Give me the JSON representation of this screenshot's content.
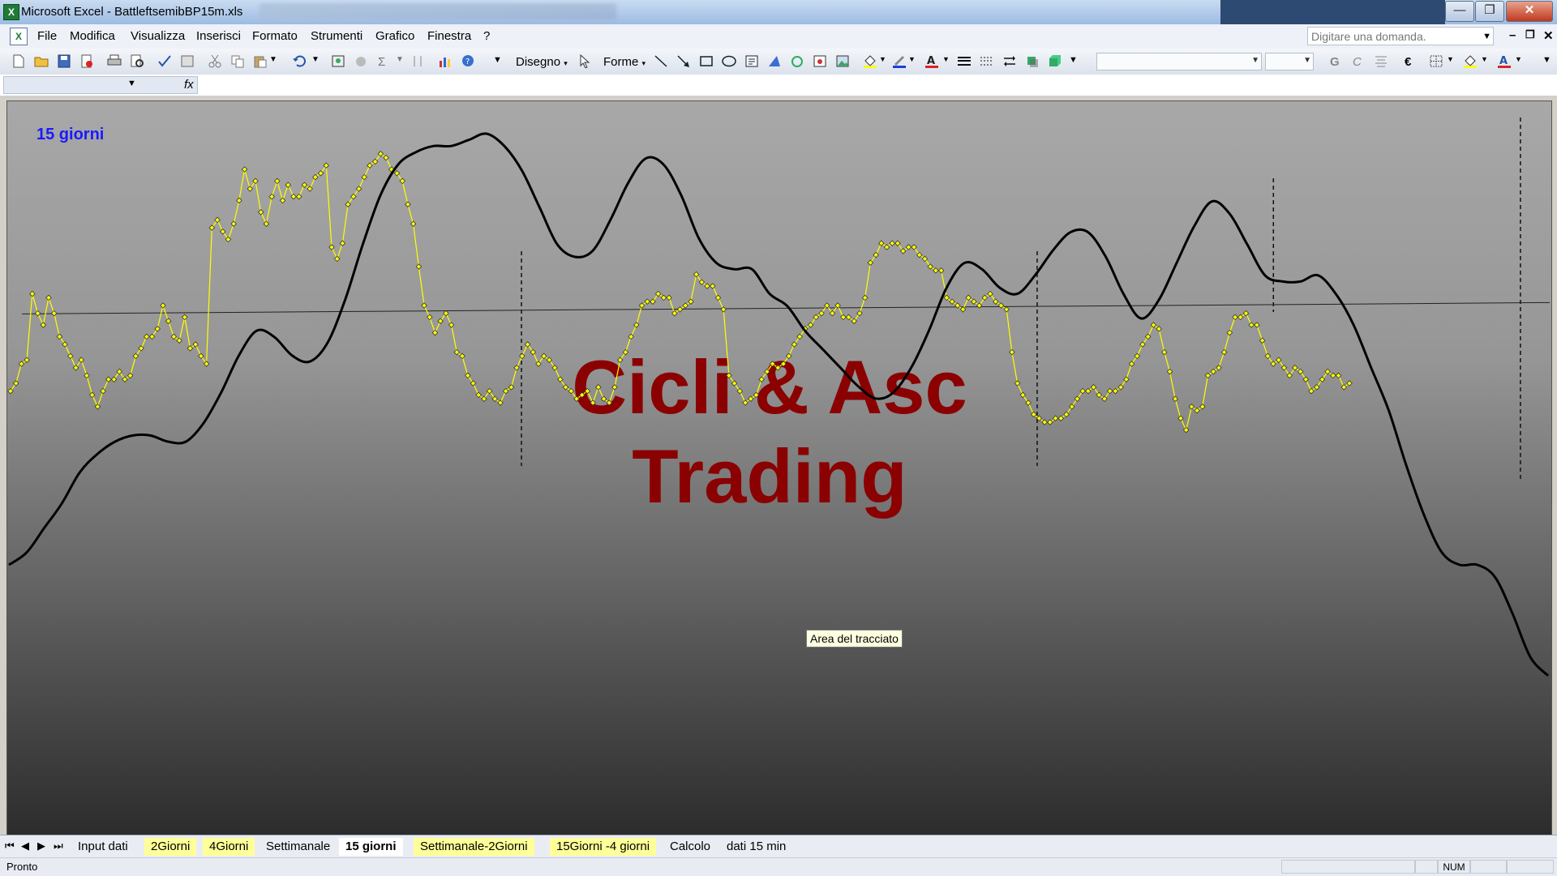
{
  "window": {
    "title": "Microsoft Excel - BattleftsemibBP15m.xls",
    "controls": {
      "minimize": "—",
      "restore": "❐",
      "close": "✕"
    }
  },
  "menubar": {
    "items": [
      "File",
      "Modifica",
      "Visualizza",
      "Inserisci",
      "Formato",
      "Strumenti",
      "Grafico",
      "Finestra",
      "?"
    ],
    "help_placeholder": "Digitare una domanda.",
    "doc_controls": {
      "minimize": "–",
      "restore": "❐",
      "close": "✕"
    }
  },
  "toolbar": {
    "drawing_label": "Disegno",
    "shapes_label": "Forme",
    "font_bold": "G",
    "font_italic": "C"
  },
  "formula_bar": {
    "name_box": "",
    "fx": "fx"
  },
  "chart": {
    "title": "15 giorni",
    "watermark_line1": "Cicli & Asc",
    "watermark_line2": "Trading",
    "tooltip": "Area del tracciato",
    "colors": {
      "background_top": "#a8a8a8",
      "background_bottom": "#2c2c2c",
      "price_line": "#ffff00",
      "cycle_line": "#000000",
      "watermark": "#8b0000",
      "title": "#1a1aff"
    }
  },
  "chart_data": {
    "type": "line",
    "title": "15 giorni",
    "series": [
      {
        "values": [
          0.38,
          0.4,
          0.45,
          0.46,
          0.63,
          0.58,
          0.55,
          0.62,
          0.58,
          0.52,
          0.5,
          0.47,
          0.44,
          0.46,
          0.42,
          0.37,
          0.34,
          0.38,
          0.41,
          0.41,
          0.43,
          0.41,
          0.42,
          0.47,
          0.49,
          0.52,
          0.52,
          0.54,
          0.6,
          0.56,
          0.52,
          0.51,
          0.57,
          0.49,
          0.5,
          0.47,
          0.45,
          0.8,
          0.82,
          0.79,
          0.77,
          0.81,
          0.87,
          0.95,
          0.9,
          0.92,
          0.84,
          0.81,
          0.88,
          0.92,
          0.87,
          0.91,
          0.88,
          0.88,
          0.91,
          0.9,
          0.93,
          0.94,
          0.96,
          0.75,
          0.72,
          0.76,
          0.86,
          0.88,
          0.9,
          0.93,
          0.96,
          0.97,
          0.99,
          0.98,
          0.95,
          0.94,
          0.92,
          0.86,
          0.81,
          0.7,
          0.6,
          0.57,
          0.53,
          0.56,
          0.58,
          0.55,
          0.48,
          0.47,
          0.42,
          0.4,
          0.37,
          0.36,
          0.38,
          0.36,
          0.35,
          0.38,
          0.39,
          0.44,
          0.47,
          0.5,
          0.48,
          0.45,
          0.47,
          0.46,
          0.44,
          0.41,
          0.39,
          0.38,
          0.36,
          0.37,
          0.38,
          0.35,
          0.39,
          0.36,
          0.35,
          0.39,
          0.46,
          0.48,
          0.52,
          0.55,
          0.6,
          0.61,
          0.61,
          0.63,
          0.62,
          0.62,
          0.58,
          0.59,
          0.6,
          0.61,
          0.68,
          0.66,
          0.65,
          0.65,
          0.62,
          0.59,
          0.42,
          0.4,
          0.38,
          0.35,
          0.36,
          0.37,
          0.41,
          0.43,
          0.45,
          0.44,
          0.45,
          0.47,
          0.5,
          0.52,
          0.54,
          0.55,
          0.57,
          0.58,
          0.6,
          0.58,
          0.6,
          0.57,
          0.57,
          0.56,
          0.58,
          0.62,
          0.71,
          0.73,
          0.76,
          0.75,
          0.76,
          0.76,
          0.74,
          0.75,
          0.75,
          0.73,
          0.72,
          0.7,
          0.69,
          0.69,
          0.62,
          0.61,
          0.6,
          0.59,
          0.62,
          0.61,
          0.6,
          0.62,
          0.63,
          0.61,
          0.6,
          0.59,
          0.48,
          0.4,
          0.37,
          0.35,
          0.32,
          0.31,
          0.3,
          0.3,
          0.31,
          0.31,
          0.32,
          0.34,
          0.36,
          0.38,
          0.38,
          0.39,
          0.37,
          0.36,
          0.38,
          0.38,
          0.39,
          0.41,
          0.45,
          0.47,
          0.5,
          0.52,
          0.55,
          0.54,
          0.48,
          0.43,
          0.36,
          0.31,
          0.28,
          0.34,
          0.33,
          0.34,
          0.42,
          0.43,
          0.44,
          0.48,
          0.53,
          0.57,
          0.57,
          0.58,
          0.55,
          0.55,
          0.51,
          0.47,
          0.45,
          0.46,
          0.44,
          0.42,
          0.44,
          0.43,
          0.41,
          0.38,
          0.39,
          0.41,
          0.43,
          0.42,
          0.42,
          0.39,
          0.4
        ]
      },
      {
        "values": [
          0.3,
          0.32,
          0.36,
          0.4,
          0.45,
          0.48,
          0.5,
          0.51,
          0.51,
          0.5,
          0.5,
          0.53,
          0.58,
          0.64,
          0.68,
          0.67,
          0.64,
          0.63,
          0.66,
          0.73,
          0.82,
          0.9,
          0.95,
          0.97,
          0.98,
          0.98,
          0.99,
          1.0,
          0.98,
          0.94,
          0.88,
          0.82,
          0.8,
          0.81,
          0.86,
          0.92,
          0.96,
          0.95,
          0.9,
          0.83,
          0.79,
          0.78,
          0.78,
          0.74,
          0.72,
          0.68,
          0.65,
          0.62,
          0.59,
          0.57,
          0.58,
          0.62,
          0.68,
          0.75,
          0.79,
          0.78,
          0.75,
          0.74,
          0.77,
          0.81,
          0.84,
          0.84,
          0.8,
          0.74,
          0.7,
          0.73,
          0.79,
          0.85,
          0.89,
          0.87,
          0.82,
          0.77,
          0.76,
          0.76,
          0.77,
          0.74,
          0.69,
          0.62,
          0.55,
          0.46,
          0.38,
          0.32,
          0.3,
          0.3,
          0.28,
          0.22,
          0.15,
          0.12
        ]
      }
    ],
    "mean_line": 0.72,
    "cycle_markers": [
      0.333,
      0.667,
      0.82,
      0.98
    ]
  },
  "sheet_tabs": [
    {
      "label": "Input dati",
      "color": "none"
    },
    {
      "label": "2Giorni",
      "color": "yellow"
    },
    {
      "label": "4Giorni",
      "color": "yellow"
    },
    {
      "label": "Settimanale",
      "color": "none"
    },
    {
      "label": "15 giorni",
      "color": "active"
    },
    {
      "label": "Settimanale-2Giorni",
      "color": "yellow"
    },
    {
      "label": "15Giorni -4 giorni",
      "color": "yellow"
    },
    {
      "label": "Calcolo",
      "color": "none"
    },
    {
      "label": "dati 15 min",
      "color": "none"
    }
  ],
  "status": {
    "text": "Pronto",
    "num": "NUM"
  }
}
